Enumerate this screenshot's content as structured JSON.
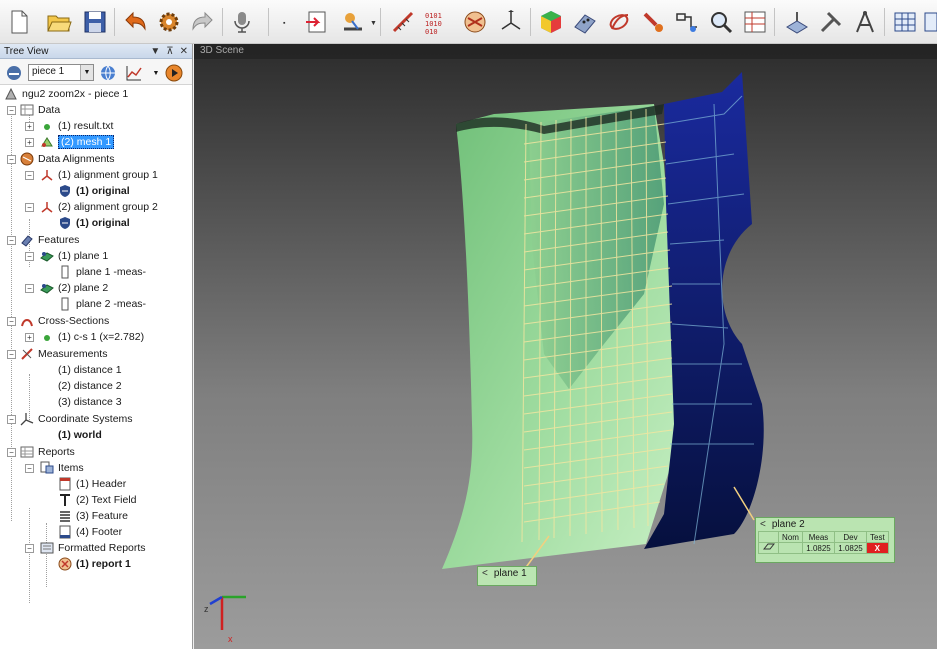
{
  "toolbar": {
    "icons": [
      "new-file-icon",
      "open-folder-icon",
      "save-icon",
      "undo-icon",
      "settings-gear-icon",
      "redo-icon",
      "microphone-icon",
      "import-icon",
      "probe-icon",
      "measure-tool-icon",
      "binary-data-icon",
      "alignment-icon",
      "axes-icon",
      "cube-icon",
      "point-cloud-icon",
      "curve-icon",
      "brush-icon",
      "comparison-icon",
      "zoom-icon",
      "report-table-icon",
      "cad-icon",
      "tools-icon",
      "compass-icon",
      "grid-table-icon"
    ]
  },
  "tree_panel": {
    "title": "Tree View",
    "piece_select": "piece 1",
    "items": {
      "root": "ngu2 zoom2x - piece 1",
      "data": "Data",
      "result": "(1) result.txt",
      "mesh": "(2) mesh 1",
      "data_alignments": "Data Alignments",
      "align1": "(1) alignment group 1",
      "align1_orig": "(1) original",
      "align2": "(2) alignment group 2",
      "align2_orig": "(1) original",
      "features": "Features",
      "plane1": "(1) plane 1",
      "plane1_meas": "plane 1 -meas-",
      "plane2": "(2) plane 2",
      "plane2_meas": "plane 2 -meas-",
      "cross_sections": "Cross-Sections",
      "cs1": "(1) c-s 1 (x=2.782)",
      "measurements": "Measurements",
      "dist1": "(1) distance 1",
      "dist2": "(2) distance 2",
      "dist3": "(3) distance 3",
      "coord_systems": "Coordinate Systems",
      "world": "(1) world",
      "reports": "Reports",
      "report_items": "Items",
      "header": "(1) Header",
      "text_field": "(2) Text Field",
      "feature": "(3) Feature",
      "footer": "(4) Footer",
      "formatted_reports": "Formatted Reports",
      "report1": "(1) report 1"
    }
  },
  "scene": {
    "title": "3D Scene",
    "plane1_label": "plane 1",
    "plane2_label": "plane 2",
    "plane2_table": {
      "headers": [
        "",
        "Nom",
        "Meas",
        "Dev",
        "Test"
      ],
      "row": [
        "",
        "",
        "1.0825",
        "1.0825",
        "X"
      ]
    },
    "axis_labels": {
      "x": "x",
      "z": "z"
    }
  },
  "colors": {
    "selection": "#3399ff",
    "plane1": "#8ed596",
    "plane2": "#0d1a6e",
    "fail": "#e02020"
  }
}
